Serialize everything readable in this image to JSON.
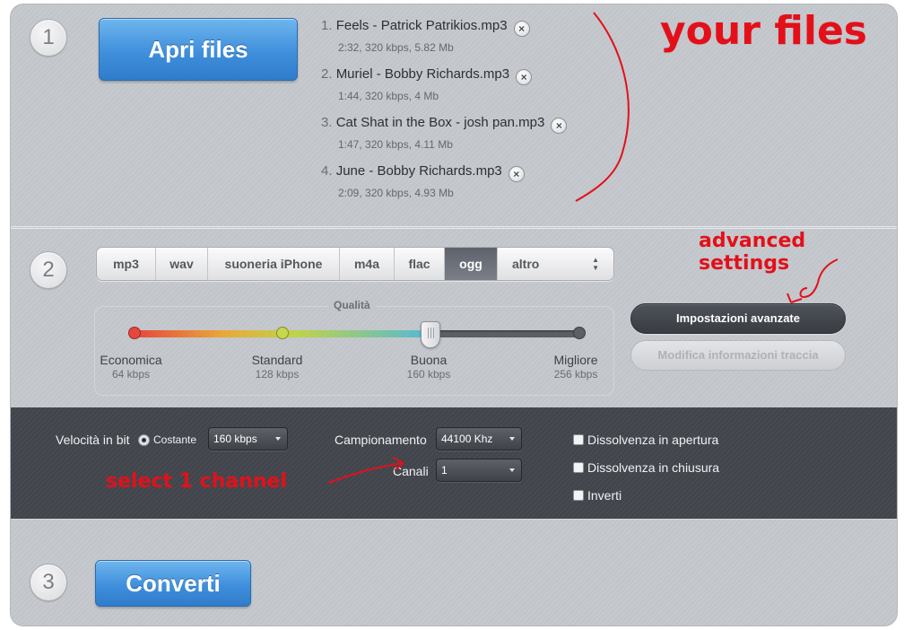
{
  "steps": {
    "step1": "1",
    "step2": "2",
    "step3": "3"
  },
  "open_button": "Apri files",
  "files": [
    {
      "index": "1.",
      "name": "Feels - Patrick Patrikios.mp3",
      "meta": "2:32, 320 kbps, 5.82 Mb"
    },
    {
      "index": "2.",
      "name": "Muriel - Bobby Richards.mp3",
      "meta": "1:44, 320 kbps, 4 Mb"
    },
    {
      "index": "3.",
      "name": "Cat Shat in the Box - josh pan.mp3",
      "meta": "1:47, 320 kbps, 4.11 Mb"
    },
    {
      "index": "4.",
      "name": "June - Bobby Richards.mp3",
      "meta": "2:09, 320 kbps, 4.93 Mb"
    }
  ],
  "remove_glyph": "×",
  "annotations": {
    "your_files": "your files",
    "advanced_settings": "advanced settings",
    "select_channel": "select  1 channel"
  },
  "formats": {
    "tabs": [
      "mp3",
      "wav",
      "suoneria iPhone",
      "m4a",
      "flac",
      "ogg",
      "altro"
    ],
    "selected": "ogg",
    "more_arrows": "▲▼"
  },
  "quality": {
    "label": "Qualità",
    "current_kbps": 160,
    "levels": [
      {
        "name": "Economica",
        "kbps": "64 kbps",
        "color": "#e6463c"
      },
      {
        "name": "Standard",
        "kbps": "128 kbps",
        "color": "#c5d84a"
      },
      {
        "name": "Buona",
        "kbps": "160 kbps",
        "color": "#52b9d7"
      },
      {
        "name": "Migliore",
        "kbps": "256 kbps",
        "color": "#5c6066"
      }
    ]
  },
  "buttons": {
    "advanced": "Impostazioni avanzate",
    "edit_track_info": "Modifica informazioni traccia",
    "convert": "Converti"
  },
  "advanced": {
    "bitrate_label": "Velocità in bit",
    "constant_label": "Costante",
    "bitrate_value": "160 kbps",
    "sample_rate_label": "Campionamento",
    "sample_rate_value": "44100 Khz",
    "channels_label": "Canali",
    "channels_value": "1",
    "fade_in": "Dissolvenza in apertura",
    "fade_out": "Dissolvenza in chiusura",
    "reverse": "Inverti"
  },
  "colors": {
    "accent_blue": "#3f8fdc",
    "annotation_red": "#e3101a",
    "panel_dark": "#44484e"
  }
}
